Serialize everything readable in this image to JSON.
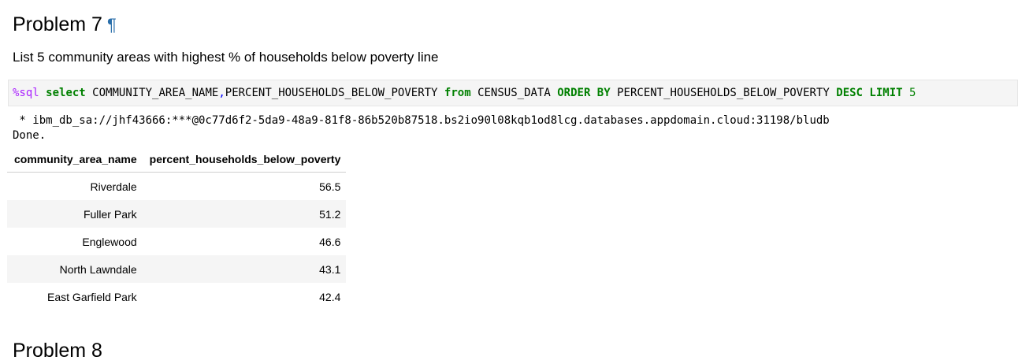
{
  "heading": {
    "title": "Problem 7",
    "anchor": "¶"
  },
  "description": "List 5 community areas with highest % of households below poverty line",
  "code": {
    "magic": "%sql",
    "kw_select": "select",
    "columns": "COMMUNITY_AREA_NAME",
    "comma": ",",
    "columns2": "PERCENT_HOUSEHOLDS_BELOW_POVERTY",
    "kw_from": "from",
    "table": "CENSUS_DATA",
    "kw_orderby": "ORDER BY",
    "order_col": "PERCENT_HOUSEHOLDS_BELOW_POVERTY",
    "kw_desc": "DESC",
    "kw_limit": "LIMIT",
    "limit_val": "5"
  },
  "output": {
    "connection": " * ibm_db_sa://jhf43666:***@0c77d6f2-5da9-48a9-81f8-86b520b87518.bs2io90l08kqb1od8lcg.databases.appdomain.cloud:31198/bludb",
    "status": "Done."
  },
  "table": {
    "headers": [
      "community_area_name",
      "percent_households_below_poverty"
    ],
    "rows": [
      [
        "Riverdale",
        "56.5"
      ],
      [
        "Fuller Park",
        "51.2"
      ],
      [
        "Englewood",
        "46.6"
      ],
      [
        "North Lawndale",
        "43.1"
      ],
      [
        "East Garfield Park",
        "42.4"
      ]
    ]
  },
  "next_heading": "Problem 8"
}
